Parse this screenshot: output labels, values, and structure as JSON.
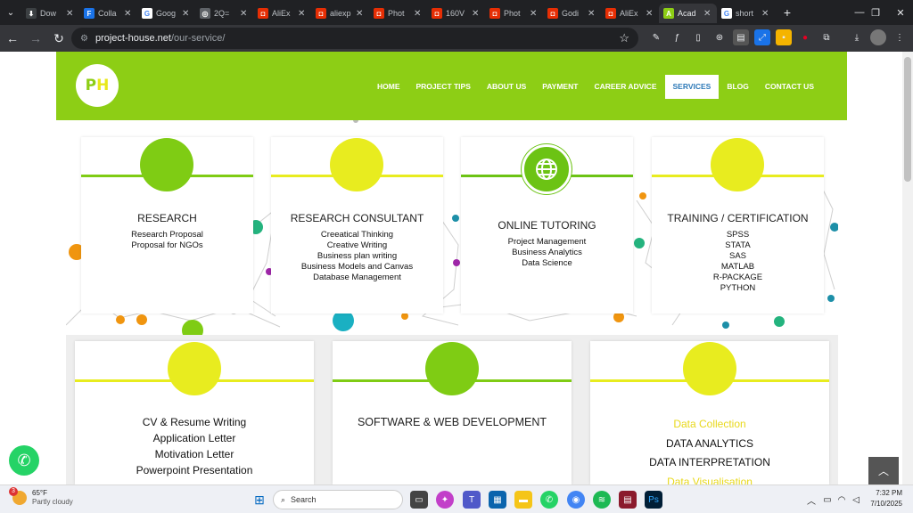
{
  "browser": {
    "tabs": [
      {
        "label": "Dow",
        "fav_color": "#3c4043",
        "fav_glyph": "⬇"
      },
      {
        "label": "Colla",
        "fav_color": "#1a73e8",
        "fav_glyph": "F"
      },
      {
        "label": "Goog",
        "fav_color": "#ffffff",
        "fav_glyph": "G"
      },
      {
        "label": "2Q=",
        "fav_color": "#5f6368",
        "fav_glyph": "◎"
      },
      {
        "label": "AliEx",
        "fav_color": "#e62e04",
        "fav_glyph": "◘"
      },
      {
        "label": "aliexp",
        "fav_color": "#e62e04",
        "fav_glyph": "◘"
      },
      {
        "label": "Phot",
        "fav_color": "#e62e04",
        "fav_glyph": "◘"
      },
      {
        "label": "160V",
        "fav_color": "#e62e04",
        "fav_glyph": "◘"
      },
      {
        "label": "Phot",
        "fav_color": "#e62e04",
        "fav_glyph": "◘"
      },
      {
        "label": "Godi",
        "fav_color": "#e62e04",
        "fav_glyph": "◘"
      },
      {
        "label": "AliEx",
        "fav_color": "#e62e04",
        "fav_glyph": "◘"
      },
      {
        "label": "Acad",
        "fav_color": "#8dce15",
        "fav_glyph": "A"
      },
      {
        "label": "short",
        "fav_color": "#ffffff",
        "fav_glyph": "G"
      }
    ],
    "active_tab_index": 11,
    "new_tab_label": "+",
    "url_host": "project-house.net",
    "url_path": "/our-service/"
  },
  "site": {
    "logo_text_p": "P",
    "logo_text_h": "H",
    "nav": [
      "HOME",
      "PROJECT TIPS",
      "ABOUT US",
      "PAYMENT",
      "CAREER ADVICE",
      "SERVICES",
      "BLOG",
      "CONTACT US"
    ],
    "active_nav": "SERVICES",
    "colors": {
      "brand_green": "#8dce15",
      "accent_yellow": "#e8e81a",
      "nav_active_text": "#2e7ab8"
    }
  },
  "services_top": [
    {
      "title": "RESEARCH",
      "lines": [
        "Research Proposal",
        "Proposal for NGOs"
      ],
      "circle_color": "#7fcc14",
      "icon": ""
    },
    {
      "title": "RESEARCH CONSULTANT",
      "lines": [
        "Creeatical Thinking",
        "Creative Writing",
        "Business plan writing",
        "Business Models and Canvas",
        "Database Management"
      ],
      "circle_color": "#e8ec1f",
      "icon": ""
    },
    {
      "title": "ONLINE TUTORING",
      "lines": [
        "Project Management",
        "Business Analytics",
        "Data Science"
      ],
      "circle_color": "#6cc314",
      "icon": "globe-icon"
    },
    {
      "title": "TRAINING / CERTIFICATION",
      "lines": [
        "SPSS",
        "STATA",
        "SAS",
        "MATLAB",
        "R-PACKAGE",
        "PYTHON"
      ],
      "circle_color": "#e8ec1f",
      "icon": ""
    }
  ],
  "services_bottom": [
    {
      "title": "",
      "lines": [
        "CV & Resume Writing",
        "Application Letter",
        "Motivation Letter",
        "Powerpoint Presentation"
      ],
      "circle_color": "#e8ec1f"
    },
    {
      "title": "SOFTWARE & WEB DEVELOPMENT",
      "lines": [],
      "circle_color": "#7fcc14"
    },
    {
      "title": "",
      "lines": [
        "Data Collection",
        "DATA ANALYTICS",
        "DATA INTERPRETATION",
        "Data Visualisation"
      ],
      "circle_color": "#e8ec1f"
    }
  ],
  "taskbar": {
    "weather_temp": "65°F",
    "weather_desc": "Partly cloudy",
    "weather_badge": "3",
    "search_label": "Search",
    "time": "7:32 PM",
    "date": "7/10/2025"
  }
}
